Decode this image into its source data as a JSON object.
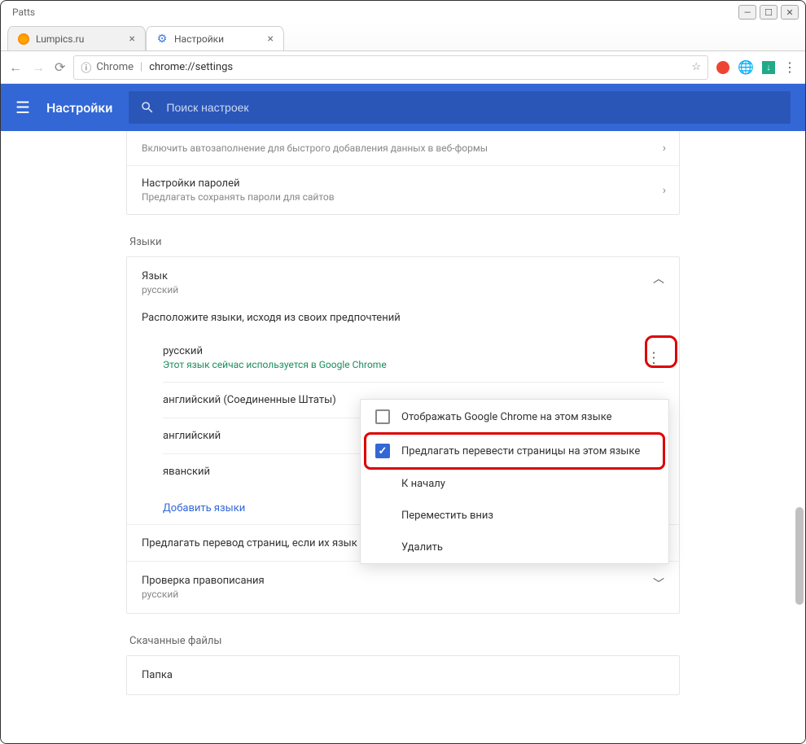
{
  "window": {
    "title": "Patts"
  },
  "tabs": [
    {
      "title": "Lumpics.ru",
      "favicon": "lumpics"
    },
    {
      "title": "Настройки",
      "favicon": "gear"
    }
  ],
  "omnibox": {
    "secure_label": "Chrome",
    "url": "chrome://settings"
  },
  "appbar": {
    "title": "Настройки",
    "search_placeholder": "Поиск настроек"
  },
  "autofill": {
    "row1_sub": "Включить автозаполнение для быстрого добавления данных в веб-формы",
    "row2_title": "Настройки паролей",
    "row2_sub": "Предлагать сохранять пароли для сайтов"
  },
  "sections": {
    "languages": "Языки",
    "downloads": "Скачанные файлы"
  },
  "lang_panel": {
    "head_title": "Язык",
    "head_sub": "русский",
    "description": "Расположите языки, исходя из своих предпочтений",
    "items": [
      {
        "name": "русский",
        "note": "Этот язык сейчас используется в Google Chrome",
        "dots": true
      },
      {
        "name": "английский (Соединенные Штаты)"
      },
      {
        "name": "английский"
      },
      {
        "name": "яванский"
      }
    ],
    "add_link": "Добавить языки",
    "translate_toggle_label": "Предлагать перевод страниц, если их язык отличается от используемого в браузере",
    "spell_title": "Проверка правописания",
    "spell_sub": "русский"
  },
  "popup": {
    "opt_display": "Отображать Google Chrome на этом языке",
    "opt_translate": "Предлагать перевести страницы на этом языке",
    "opt_top": "К началу",
    "opt_down": "Переместить вниз",
    "opt_delete": "Удалить"
  },
  "downloads": {
    "folder_label": "Папка"
  }
}
